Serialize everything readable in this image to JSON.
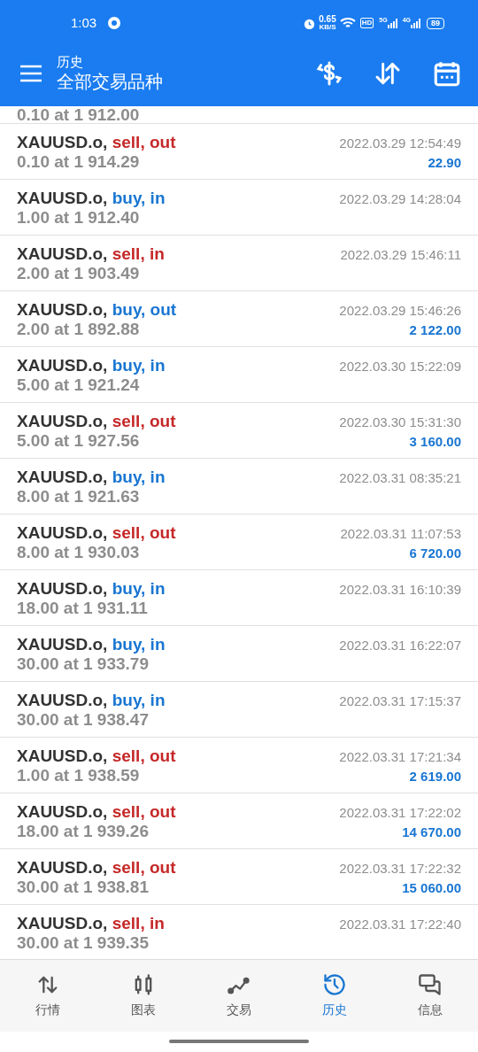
{
  "status_bar": {
    "time": "1:03",
    "speed": "0.65",
    "speed_unit": "KB/S",
    "hd": "HD",
    "net1": "5G",
    "net2": "4G",
    "battery": "89"
  },
  "header": {
    "subtitle": "历史",
    "title": "全部交易品种"
  },
  "partial_row": {
    "volume": "0.10 at 1 912.00"
  },
  "rows": [
    {
      "symbol": "XAUUSD.o,",
      "kind": "sell",
      "action": "sell, out",
      "volume": "0.10 at 1 914.29",
      "time": "2022.03.29 12:54:49",
      "profit": "22.90"
    },
    {
      "symbol": "XAUUSD.o,",
      "kind": "buy",
      "action": "buy, in",
      "volume": "1.00 at 1 912.40",
      "time": "2022.03.29 14:28:04"
    },
    {
      "symbol": "XAUUSD.o,",
      "kind": "sell",
      "action": "sell, in",
      "volume": "2.00 at 1 903.49",
      "time": "2022.03.29 15:46:11"
    },
    {
      "symbol": "XAUUSD.o,",
      "kind": "buy",
      "action": "buy, out",
      "volume": "2.00 at 1 892.88",
      "time": "2022.03.29 15:46:26",
      "profit": "2 122.00"
    },
    {
      "symbol": "XAUUSD.o,",
      "kind": "buy",
      "action": "buy, in",
      "volume": "5.00 at 1 921.24",
      "time": "2022.03.30 15:22:09"
    },
    {
      "symbol": "XAUUSD.o,",
      "kind": "sell",
      "action": "sell, out",
      "volume": "5.00 at 1 927.56",
      "time": "2022.03.30 15:31:30",
      "profit": "3 160.00"
    },
    {
      "symbol": "XAUUSD.o,",
      "kind": "buy",
      "action": "buy, in",
      "volume": "8.00 at 1 921.63",
      "time": "2022.03.31 08:35:21"
    },
    {
      "symbol": "XAUUSD.o,",
      "kind": "sell",
      "action": "sell, out",
      "volume": "8.00 at 1 930.03",
      "time": "2022.03.31 11:07:53",
      "profit": "6 720.00"
    },
    {
      "symbol": "XAUUSD.o,",
      "kind": "buy",
      "action": "buy, in",
      "volume": "18.00 at 1 931.11",
      "time": "2022.03.31 16:10:39"
    },
    {
      "symbol": "XAUUSD.o,",
      "kind": "buy",
      "action": "buy, in",
      "volume": "30.00 at 1 933.79",
      "time": "2022.03.31 16:22:07"
    },
    {
      "symbol": "XAUUSD.o,",
      "kind": "buy",
      "action": "buy, in",
      "volume": "30.00 at 1 938.47",
      "time": "2022.03.31 17:15:37"
    },
    {
      "symbol": "XAUUSD.o,",
      "kind": "sell",
      "action": "sell, out",
      "volume": "1.00 at 1 938.59",
      "time": "2022.03.31 17:21:34",
      "profit": "2 619.00"
    },
    {
      "symbol": "XAUUSD.o,",
      "kind": "sell",
      "action": "sell, out",
      "volume": "18.00 at 1 939.26",
      "time": "2022.03.31 17:22:02",
      "profit": "14 670.00"
    },
    {
      "symbol": "XAUUSD.o,",
      "kind": "sell",
      "action": "sell, out",
      "volume": "30.00 at 1 938.81",
      "time": "2022.03.31 17:22:32",
      "profit": "15 060.00"
    },
    {
      "symbol": "XAUUSD.o,",
      "kind": "sell",
      "action": "sell, in",
      "volume": "30.00 at 1 939.35",
      "time": "2022.03.31 17:22:40"
    }
  ],
  "nav": [
    {
      "label": "行情",
      "kind": "quotes",
      "selected": false
    },
    {
      "label": "图表",
      "kind": "chart",
      "selected": false
    },
    {
      "label": "交易",
      "kind": "trade",
      "selected": false
    },
    {
      "label": "历史",
      "kind": "history",
      "selected": true
    },
    {
      "label": "信息",
      "kind": "messages",
      "selected": false
    }
  ]
}
